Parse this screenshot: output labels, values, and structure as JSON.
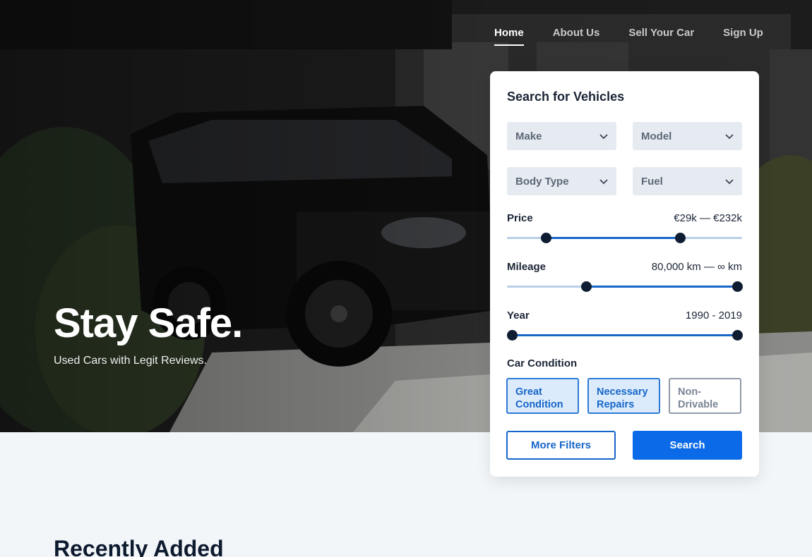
{
  "nav": {
    "items": [
      {
        "label": "Home",
        "active": true
      },
      {
        "label": "About Us",
        "active": false
      },
      {
        "label": "Sell Your Car",
        "active": false
      },
      {
        "label": "Sign Up",
        "active": false
      }
    ]
  },
  "hero": {
    "headline": "Stay Safe.",
    "subline": "Used Cars with Legit Reviews."
  },
  "search": {
    "title": "Search for Vehicles",
    "selects": {
      "make": "Make",
      "model": "Model",
      "body_type": "Body Type",
      "fuel": "Fuel"
    },
    "price": {
      "label": "Price",
      "value": "€29k — €232k",
      "low_fraction": 0.165,
      "high_fraction": 0.735
    },
    "mileage": {
      "label": "Mileage",
      "value": "80,000 km — ∞ km",
      "low_fraction": 0.337,
      "high_fraction": 0.98
    },
    "year": {
      "label": "Year",
      "value": "1990 - 2019",
      "low_fraction": 0.02,
      "high_fraction": 0.98
    },
    "condition": {
      "title": "Car Condition",
      "options": [
        {
          "label": "Great Condition",
          "selected": true
        },
        {
          "label": "Necessary Repairs",
          "selected": true
        },
        {
          "label": "Non-Drivable",
          "selected": false
        }
      ]
    },
    "more_filters": "More Filters",
    "search_button": "Search"
  },
  "recent": {
    "title": "Recently Added"
  },
  "colors": {
    "accent": "#0b6ae8",
    "slider_dark": "#0f1d33",
    "select_bg": "#e6ebf1",
    "page_bg": "#f3f6f9"
  }
}
